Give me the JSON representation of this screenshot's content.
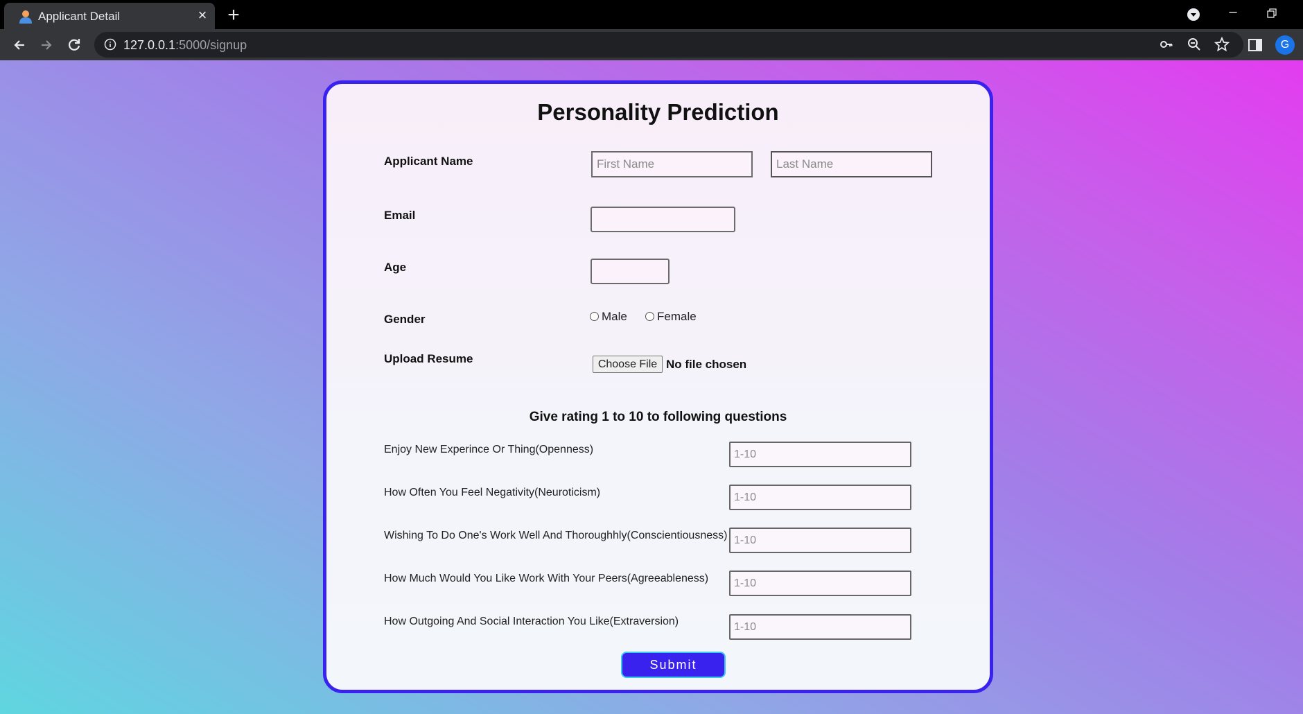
{
  "browser": {
    "tab_title": "Applicant Detail",
    "url_host": "127.0.0.1",
    "url_rest": ":5000/signup",
    "profile_initial": "G"
  },
  "form": {
    "title": "Personality Prediction",
    "applicant_name_label": "Applicant Name",
    "first_name_placeholder": "First Name",
    "last_name_placeholder": "Last Name",
    "first_name_value": "",
    "last_name_value": "",
    "email_label": "Email",
    "email_value": "",
    "age_label": "Age",
    "age_value": "",
    "gender_label": "Gender",
    "gender_options": [
      "Male",
      "Female"
    ],
    "gender_selected": null,
    "resume_label": "Upload Resume",
    "choose_file_label": "Choose File",
    "no_file_text": "No file chosen",
    "rating_heading": "Give rating 1 to 10 to following questions",
    "questions": [
      {
        "label": "Enjoy New Experince Or Thing(Openness)",
        "placeholder": "1-10"
      },
      {
        "label": "How Often You Feel Negativity(Neuroticism)",
        "placeholder": "1-10"
      },
      {
        "label": "Wishing To Do One's Work Well And Thoroughhly(Conscientiousness)",
        "placeholder": "1-10"
      },
      {
        "label": "How Much Would You Like Work With Your Peers(Agreeableness)",
        "placeholder": "1-10"
      },
      {
        "label": "How Outgoing And Social Interaction You Like(Extraversion)",
        "placeholder": "1-10"
      }
    ],
    "submit_label": "Submit"
  },
  "colors": {
    "card_border": "#3a22ee",
    "submit_bg": "#3a22ee",
    "submit_border": "#38c8f0",
    "gradient_start": "#5fd6e0",
    "gradient_end": "#e33cf0"
  }
}
